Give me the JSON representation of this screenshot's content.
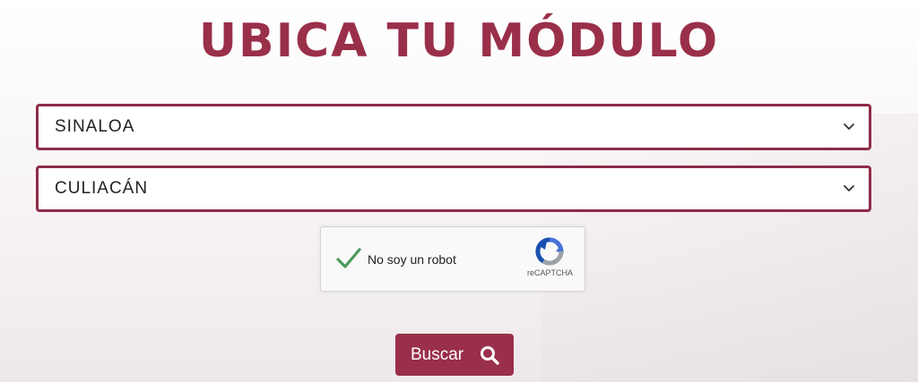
{
  "page": {
    "title": "UBICA TU MÓDULO"
  },
  "form": {
    "state_select": {
      "value": "SINALOA"
    },
    "city_select": {
      "value": "CULIACÁN"
    },
    "captcha": {
      "label": "No soy un robot",
      "brand": "reCAPTCHA",
      "checked": true
    },
    "search_button": {
      "label": "Buscar",
      "icon": "search-icon"
    }
  },
  "colors": {
    "brand": "#9a2f4a",
    "border": "#8e2c47",
    "check": "#4a9a5a"
  }
}
